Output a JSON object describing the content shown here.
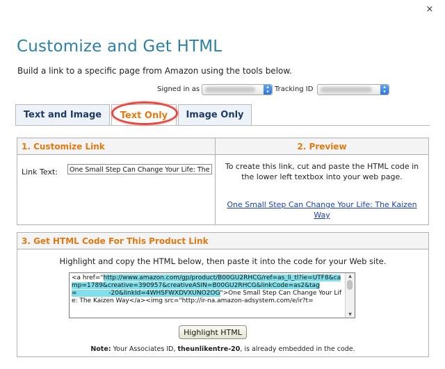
{
  "dialog": {
    "title": "Customize and Get HTML",
    "subtitle": "Build a link to a specific page from Amazon using the tools below.",
    "close_glyph": "×"
  },
  "account": {
    "signed_in_label": "Signed in as",
    "tracking_id_label": "Tracking ID"
  },
  "tabs": [
    {
      "label": "Text and Image",
      "active": false
    },
    {
      "label": "Text Only",
      "active": true
    },
    {
      "label": "Image Only",
      "active": false
    }
  ],
  "customize": {
    "heading": "1. Customize Link",
    "link_text_label": "Link Text:",
    "link_text_value": "One Small Step Can Change Your Life: The Kaizen Way"
  },
  "preview": {
    "heading": "2. Preview",
    "instructions": "To create this link, cut and paste the HTML code in the lower left textbox into your web page.",
    "link_text": "One Small Step Can Change Your Life: The Kaizen Way"
  },
  "html_code": {
    "heading": "3. Get HTML Code For This Product Link",
    "instructions": "Highlight and copy the HTML below, then paste it into the code for your Web site.",
    "code_prefix": "<a href=\"",
    "code_highlighted": "http://www.amazon.com/gp/product/B00GU2RHCG/ref=as_li_tl?ie=UTF8&camp=1789&creative=390957&creativeASIN=B00GU2RHCG&linkCode=as2&tag=                -20&linkId=4WHSFWXDVXUNO2OG",
    "code_suffix": "\">One Small Step Can Change Your Life: The Kaizen Way</a><img src=\"http://ir-na.amazon-adsystem.com/e/ir?t=",
    "button_label": "Highlight HTML",
    "note_label": "Note:",
    "note_text_before": " Your Associates ID, ",
    "associates_id": "theunlikentre-20",
    "note_text_after": ", is already embedded in the code."
  },
  "colors": {
    "title": "#2b80a4",
    "section_heading": "#e47911",
    "active_tab": "#e47911",
    "highlight_oval": "#e8483f",
    "link": "#1a3fb0",
    "code_selection": "#7fe0ec"
  }
}
